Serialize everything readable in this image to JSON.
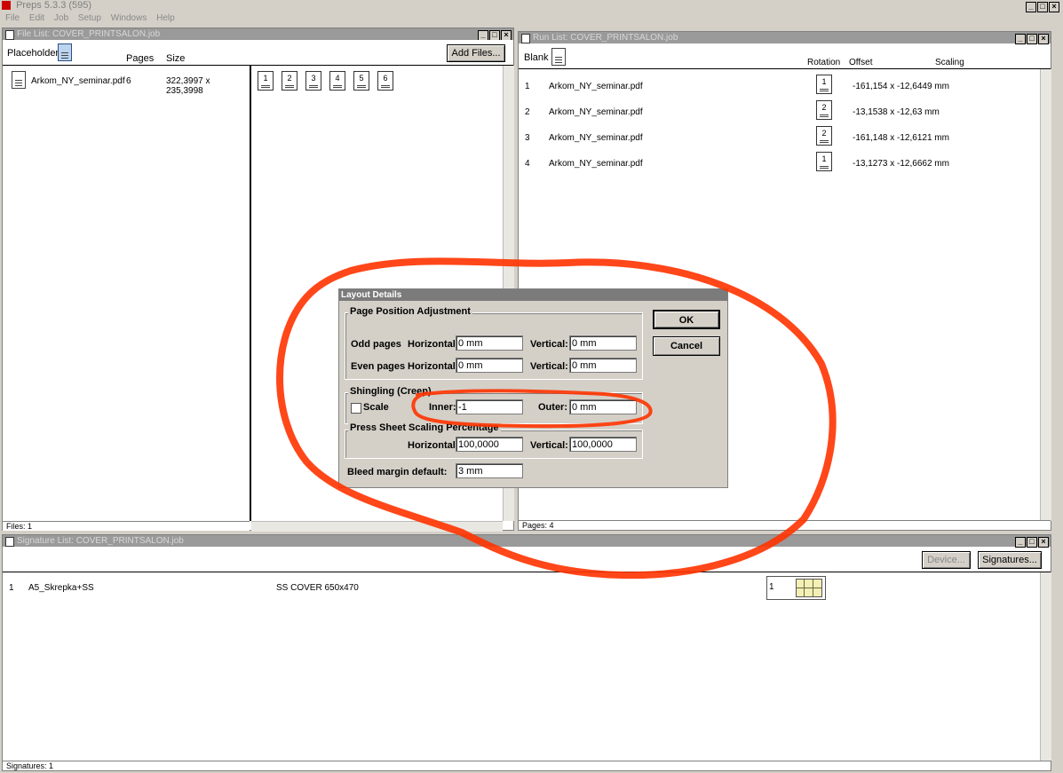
{
  "app": {
    "title": "Preps 5.3.3 (595)",
    "menu": [
      "File",
      "Edit",
      "Job",
      "Setup",
      "Windows",
      "Help"
    ]
  },
  "file_list": {
    "title": "File List: COVER_PRINTSALON.job",
    "placeholder_label": "Placeholder",
    "col_pages": "Pages",
    "col_size": "Size",
    "add_files_label": "Add Files...",
    "file": {
      "name": "Arkom_NY_seminar.pdf",
      "pages": "6",
      "size": "322,3997 x 235,3998"
    },
    "page_thumbs": [
      "1",
      "2",
      "3",
      "4",
      "5",
      "6"
    ],
    "status": "Files: 1"
  },
  "run_list": {
    "title": "Run List: COVER_PRINTSALON.job",
    "blank_label": "Blank",
    "col_rotation": "Rotation",
    "col_offset": "Offset",
    "col_scaling": "Scaling",
    "rows": [
      {
        "num": "1",
        "name": "Arkom_NY_seminar.pdf",
        "page": "1",
        "offset": "-161,154 x -12,6449 mm"
      },
      {
        "num": "2",
        "name": "Arkom_NY_seminar.pdf",
        "page": "2",
        "offset": "-13,1538 x -12,63 mm"
      },
      {
        "num": "3",
        "name": "Arkom_NY_seminar.pdf",
        "page": "2",
        "offset": "-161,148 x -12,6121 mm"
      },
      {
        "num": "4",
        "name": "Arkom_NY_seminar.pdf",
        "page": "1",
        "offset": "-13,1273 x -12,6662 mm"
      }
    ],
    "status": "Pages: 4"
  },
  "signature_list": {
    "title": "Signature List: COVER_PRINTSALON.job",
    "device_label": "Device...",
    "signatures_label": "Signatures...",
    "row": {
      "num": "1",
      "name": "A5_Skrepka+SS",
      "sheet": "SS COVER 650x470",
      "count": "1"
    },
    "status": "Signatures: 1"
  },
  "dialog": {
    "title": "Layout Details",
    "page_position_title": "Page Position Adjustment",
    "odd_pages": "Odd pages",
    "even_pages": "Even pages",
    "horizontal": "Horizontal",
    "vertical": "Vertical:",
    "odd_h": "0 mm",
    "odd_v": "0 mm",
    "even_h": "0 mm",
    "even_v": "0 mm",
    "shingling_title": "Shingling (Creep)",
    "scale_label": "Scale",
    "inner_label": "Inner:",
    "inner_value": "-1",
    "outer_label": "Outer:",
    "outer_value": "0 mm",
    "press_title": "Press Sheet Scaling Percentage",
    "press_h": "100,0000",
    "press_v": "100,0000",
    "bleed_label": "Bleed margin default:",
    "bleed_value": "3 mm",
    "ok_label": "OK",
    "cancel_label": "Cancel"
  },
  "colors": {
    "annotation": "#ff3300"
  }
}
